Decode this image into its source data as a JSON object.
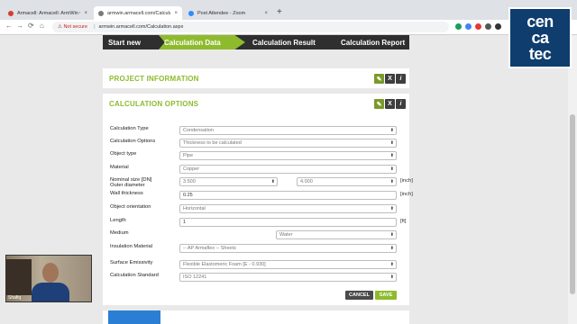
{
  "browser": {
    "tabs": [
      {
        "title": "Armacell: Armacell: ArmWin Calc",
        "close": "×",
        "color": "#d23f31"
      },
      {
        "title": "armwin.armacell.com/Calculation",
        "close": "×",
        "color": "#7a7a7a"
      },
      {
        "title": "Post Attendee - Zoom",
        "close": "×",
        "color": "#2d8cff"
      }
    ],
    "new_tab": "+",
    "nav": {
      "back": "←",
      "forward": "→",
      "reload": "⟳",
      "home": "⌂"
    },
    "address": {
      "warning": "⚠ Not secure",
      "url": "armwin.armacell.com/Calculation.aspx"
    }
  },
  "steps": [
    {
      "label": "Start new"
    },
    {
      "label": "Calculation Data"
    },
    {
      "label": "Calculation Result"
    },
    {
      "label": "Calculation Report"
    }
  ],
  "project_info": {
    "title": "PROJECT INFORMATION"
  },
  "calc_options": {
    "title": "CALCULATION OPTIONS",
    "header_buttons": {
      "edit": "✎",
      "delete": "X",
      "info": "i"
    },
    "fields": {
      "calculation_type": {
        "label": "Calculation Type",
        "value": "Condensation"
      },
      "calculation_options": {
        "label": "Calculation Options",
        "value": "Thickness to be calculated"
      },
      "object_type": {
        "label": "Object type",
        "value": "Pipe"
      },
      "material": {
        "label": "Material",
        "value": "Copper"
      },
      "nominal_size": {
        "label": "Nominal size [DN]",
        "value": "3.500"
      },
      "outer_diameter": {
        "label": "Outer diameter",
        "value": "4.000",
        "unit": "[inch]"
      },
      "wall_thickness": {
        "label": "Wall thickness",
        "value": "0.25",
        "unit": "[inch]"
      },
      "object_orientation": {
        "label": "Object orientation",
        "value": "Horizontal"
      },
      "length": {
        "label": "Length",
        "value": "1",
        "unit": "[ft]"
      },
      "medium": {
        "label": "Medium",
        "value": "Water"
      },
      "insulation_material": {
        "label": "Insulation Material",
        "value": "-- AP Armaflex -- Sheets"
      },
      "surface_emissivity": {
        "label": "Surface Emissivity",
        "value": "Flexible Elastomeric Foam [E - 0.930]"
      },
      "calculation_standard": {
        "label": "Calculation Standard",
        "value": "ISO 12241"
      }
    },
    "buttons": {
      "cancel": "CANCEL",
      "save": "SAVE"
    }
  },
  "logo": {
    "line1": "cen",
    "line2": "ca",
    "line3": "tec"
  },
  "webcam": {
    "name": "Shafiq"
  },
  "colors": {
    "accent": "#8dbb2d",
    "steps_bg": "#2f2f2f",
    "logo_bg": "#0e3d6e"
  }
}
